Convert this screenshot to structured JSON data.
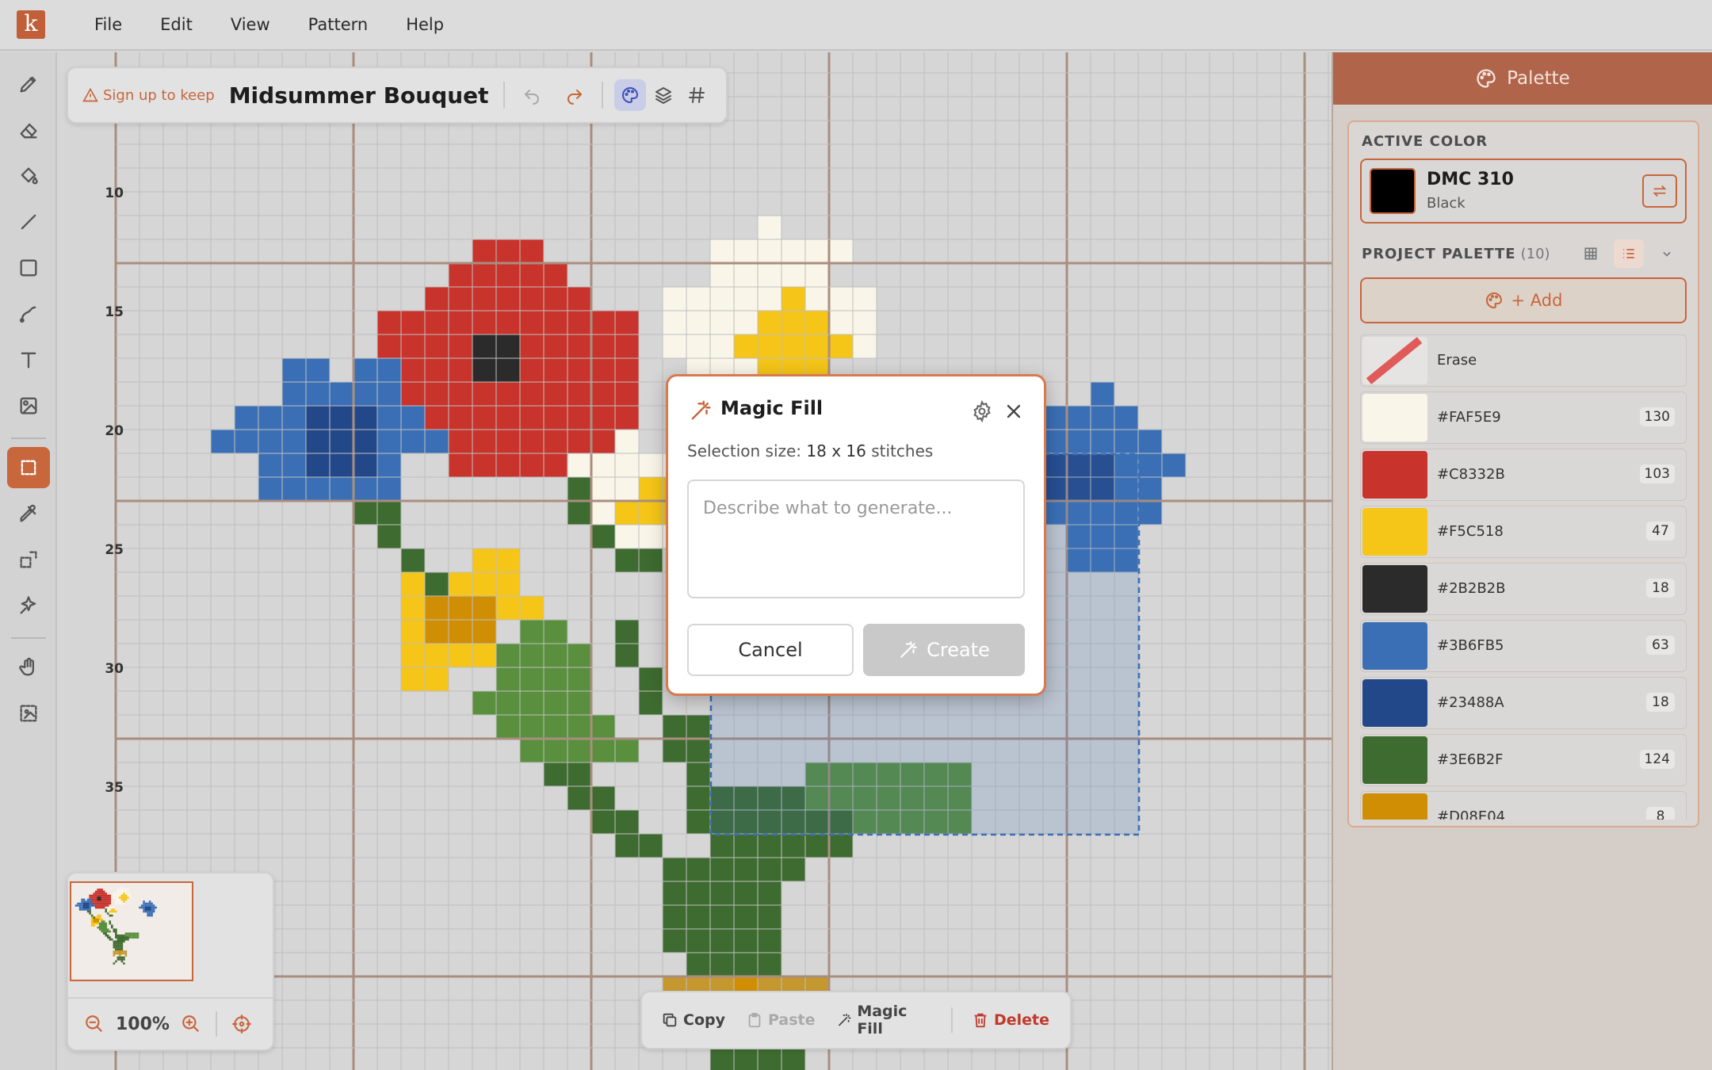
{
  "app": {
    "logo_letter": "k",
    "menu": [
      "File",
      "Edit",
      "View",
      "Pattern",
      "Help"
    ]
  },
  "toolbar": {
    "tools": [
      {
        "icon": "pencil-icon",
        "name": "pencil"
      },
      {
        "icon": "eraser-icon",
        "name": "eraser"
      },
      {
        "icon": "paint-bucket-icon",
        "name": "fill"
      },
      {
        "icon": "line-icon",
        "name": "line"
      },
      {
        "icon": "rectangle-icon",
        "name": "rectangle"
      },
      {
        "icon": "curve-icon",
        "name": "curve"
      },
      {
        "icon": "text-icon",
        "name": "text"
      },
      {
        "icon": "image-icon",
        "name": "image"
      },
      {
        "icon": "select-icon",
        "name": "select",
        "active": true
      },
      {
        "icon": "eyedropper-icon",
        "name": "eyedropper"
      },
      {
        "icon": "magic-select-icon",
        "name": "magic-select"
      },
      {
        "icon": "sparkle-icon",
        "name": "magic-fill"
      },
      {
        "icon": "hand-icon",
        "name": "pan"
      },
      {
        "icon": "image-select-icon",
        "name": "image-select"
      }
    ]
  },
  "project": {
    "signup_text": "Sign up to keep",
    "title": "Midsummer Bouquet"
  },
  "canvas": {
    "row_labels": [
      "10",
      "15",
      "20",
      "25",
      "30",
      "35"
    ],
    "grid_origin_row": 6,
    "zoom": "100%"
  },
  "selection_bar": {
    "copy": "Copy",
    "paste": "Paste",
    "magic_fill": "Magic Fill",
    "delete": "Delete"
  },
  "dialog": {
    "title": "Magic Fill",
    "selection_label": "Selection size:",
    "selection_w": "18",
    "selection_x": "x",
    "selection_h": "16",
    "selection_unit": "stitches",
    "input_value": "",
    "input_placeholder": "Describe what to generate...",
    "cancel": "Cancel",
    "create": "Create"
  },
  "panel": {
    "title": "Palette",
    "active_label": "ACTIVE COLOR",
    "active_name": "DMC 310",
    "active_sub": "Black",
    "active_color": "#000000",
    "project_palette_label": "PROJECT PALETTE",
    "project_palette_count": "(10)",
    "add_label": "+ Add",
    "erase_label": "Erase",
    "colors": [
      {
        "hex": "#FAF5E9",
        "count": "130"
      },
      {
        "hex": "#C8332B",
        "count": "103"
      },
      {
        "hex": "#F5C518",
        "count": "47"
      },
      {
        "hex": "#2B2B2B",
        "count": "18"
      },
      {
        "hex": "#3B6FB5",
        "count": "63"
      },
      {
        "hex": "#23488A",
        "count": "18"
      },
      {
        "hex": "#3E6B2F",
        "count": "124"
      },
      {
        "hex": "#D08E04",
        "count": "8"
      }
    ]
  },
  "colors": {
    "accent": "#C8663C",
    "selection": "#3B6FB5"
  }
}
